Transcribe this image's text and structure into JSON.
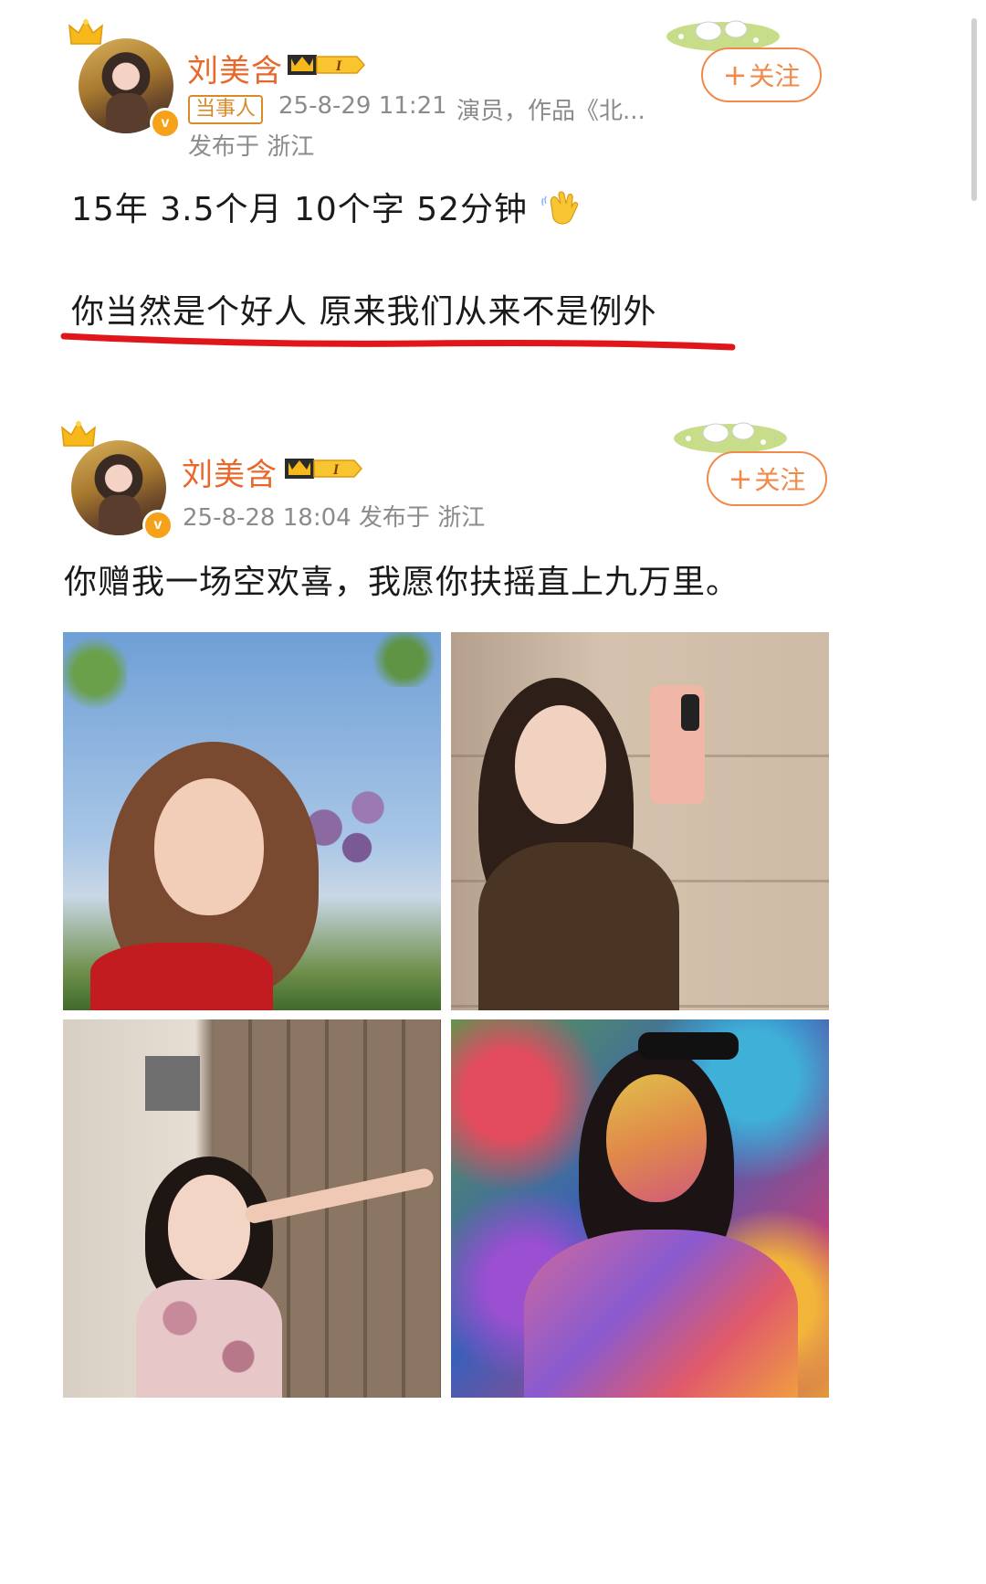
{
  "posts": [
    {
      "author": "刘美含",
      "vip_level": "I",
      "tag": "当事人",
      "timestamp": "25-8-29 11:21",
      "bio": "演员，作品《北...",
      "location": "发布于 浙江",
      "follow_label": "关注",
      "content": [
        "15年 3.5个月 10个字 52分钟",
        "你当然是个好人   原来我们从来不是例外"
      ],
      "emoji": "waving-hand"
    },
    {
      "author": "刘美含",
      "vip_level": "I",
      "meta": "25-8-28 18:04   发布于 浙江",
      "follow_label": "关注",
      "content": "你赠我一场空欢喜，我愿你扶摇直上九万里。",
      "photos": [
        "photo-sky-flowers",
        "photo-mirror-selfie",
        "photo-wooden-door",
        "photo-colorful-lights"
      ]
    }
  ],
  "colors": {
    "username": "#e8672a",
    "follow": "#f08a4a",
    "underline": "#e0161a",
    "meta": "#8b8b8b"
  }
}
